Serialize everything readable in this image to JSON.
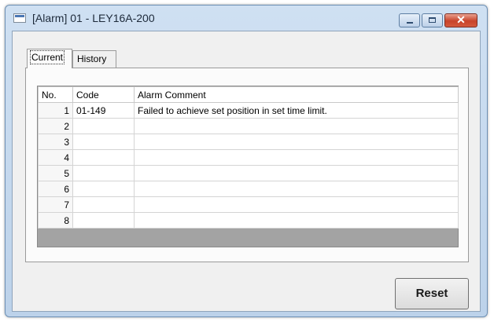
{
  "window": {
    "title": "[Alarm] 01 - LEY16A-200",
    "controls": {
      "minimize": "minimize-icon",
      "maximize": "maximize-icon",
      "close": "close-icon",
      "close_glyph": "✕"
    }
  },
  "tabs": [
    {
      "label": "Current",
      "active": true
    },
    {
      "label": "History",
      "active": false
    }
  ],
  "table": {
    "headers": [
      "No.",
      "Code",
      "Alarm Comment"
    ],
    "rows": [
      {
        "no": "1",
        "code": "01-149",
        "comment": "Failed to achieve set position in set time limit."
      },
      {
        "no": "2",
        "code": "",
        "comment": ""
      },
      {
        "no": "3",
        "code": "",
        "comment": ""
      },
      {
        "no": "4",
        "code": "",
        "comment": ""
      },
      {
        "no": "5",
        "code": "",
        "comment": ""
      },
      {
        "no": "6",
        "code": "",
        "comment": ""
      },
      {
        "no": "7",
        "code": "",
        "comment": ""
      },
      {
        "no": "8",
        "code": "",
        "comment": ""
      }
    ]
  },
  "buttons": {
    "reset": "Reset"
  },
  "colors": {
    "titlebar": "#cfe0f2",
    "close_button": "#c8432a",
    "client": "#f0f0f0"
  }
}
